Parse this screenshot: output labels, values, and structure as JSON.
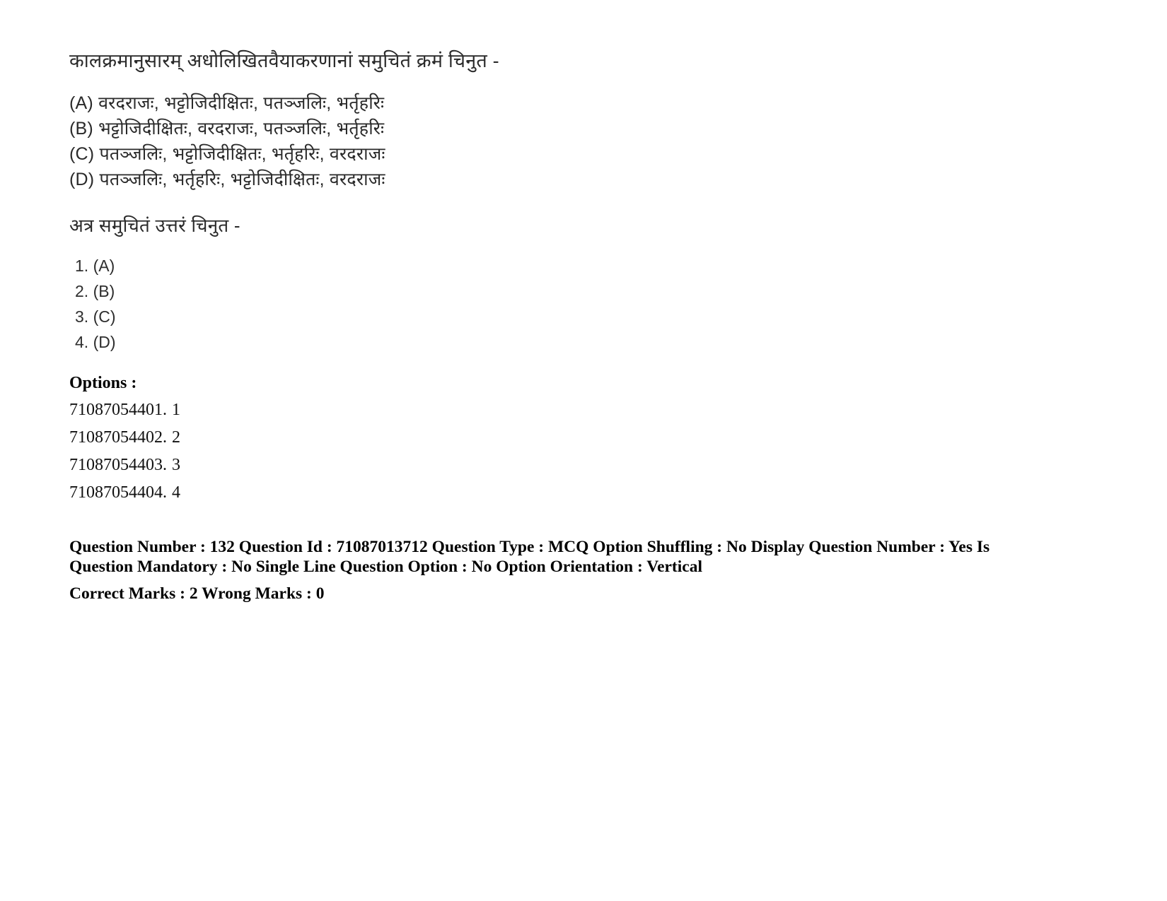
{
  "question": {
    "stem": "कालक्रमानुसारम् अधोलिखितवैयाकरणानां समुचितं क्रमं चिनुत -",
    "choices": [
      "(A) वरदराजः, भट्टोजिदीक्षितः, पतञ्जलिः, भर्तृहरिः",
      "(B) भट्टोजिदीक्षितः, वरदराजः, पतञ्जलिः, भर्तृहरिः",
      "(C) पतञ्जलिः, भट्टोजिदीक्षितः, भर्तृहरिः, वरदराजः",
      "(D)  पतञ्जलिः, भर्तृहरिः, भट्टोजिदीक्षितः, वरदराजः"
    ],
    "sub_stem": "अत्र समुचितं उत्तरं चिनुत -",
    "answers": [
      "1. (A)",
      "2. (B)",
      "3. (C)",
      "4. (D)"
    ]
  },
  "options": {
    "heading": "Options :",
    "rows": [
      {
        "id": "71087054401.",
        "value": "1"
      },
      {
        "id": "71087054402.",
        "value": "2"
      },
      {
        "id": "71087054403.",
        "value": "3"
      },
      {
        "id": "71087054404.",
        "value": "4"
      }
    ]
  },
  "meta": {
    "line1": "Question Number : 132 Question Id : 71087013712 Question Type : MCQ Option Shuffling : No Display Question Number : Yes Is Question Mandatory : No Single Line Question Option : No Option Orientation : Vertical",
    "line2": "Correct Marks : 2 Wrong Marks : 0",
    "question_number": "132",
    "question_id": "71087013712",
    "question_type": "MCQ",
    "option_shuffling": "No",
    "display_question_number": "Yes",
    "is_question_mandatory": "No",
    "single_line_question_option": "No",
    "option_orientation": "Vertical",
    "correct_marks": "2",
    "wrong_marks": "0"
  }
}
